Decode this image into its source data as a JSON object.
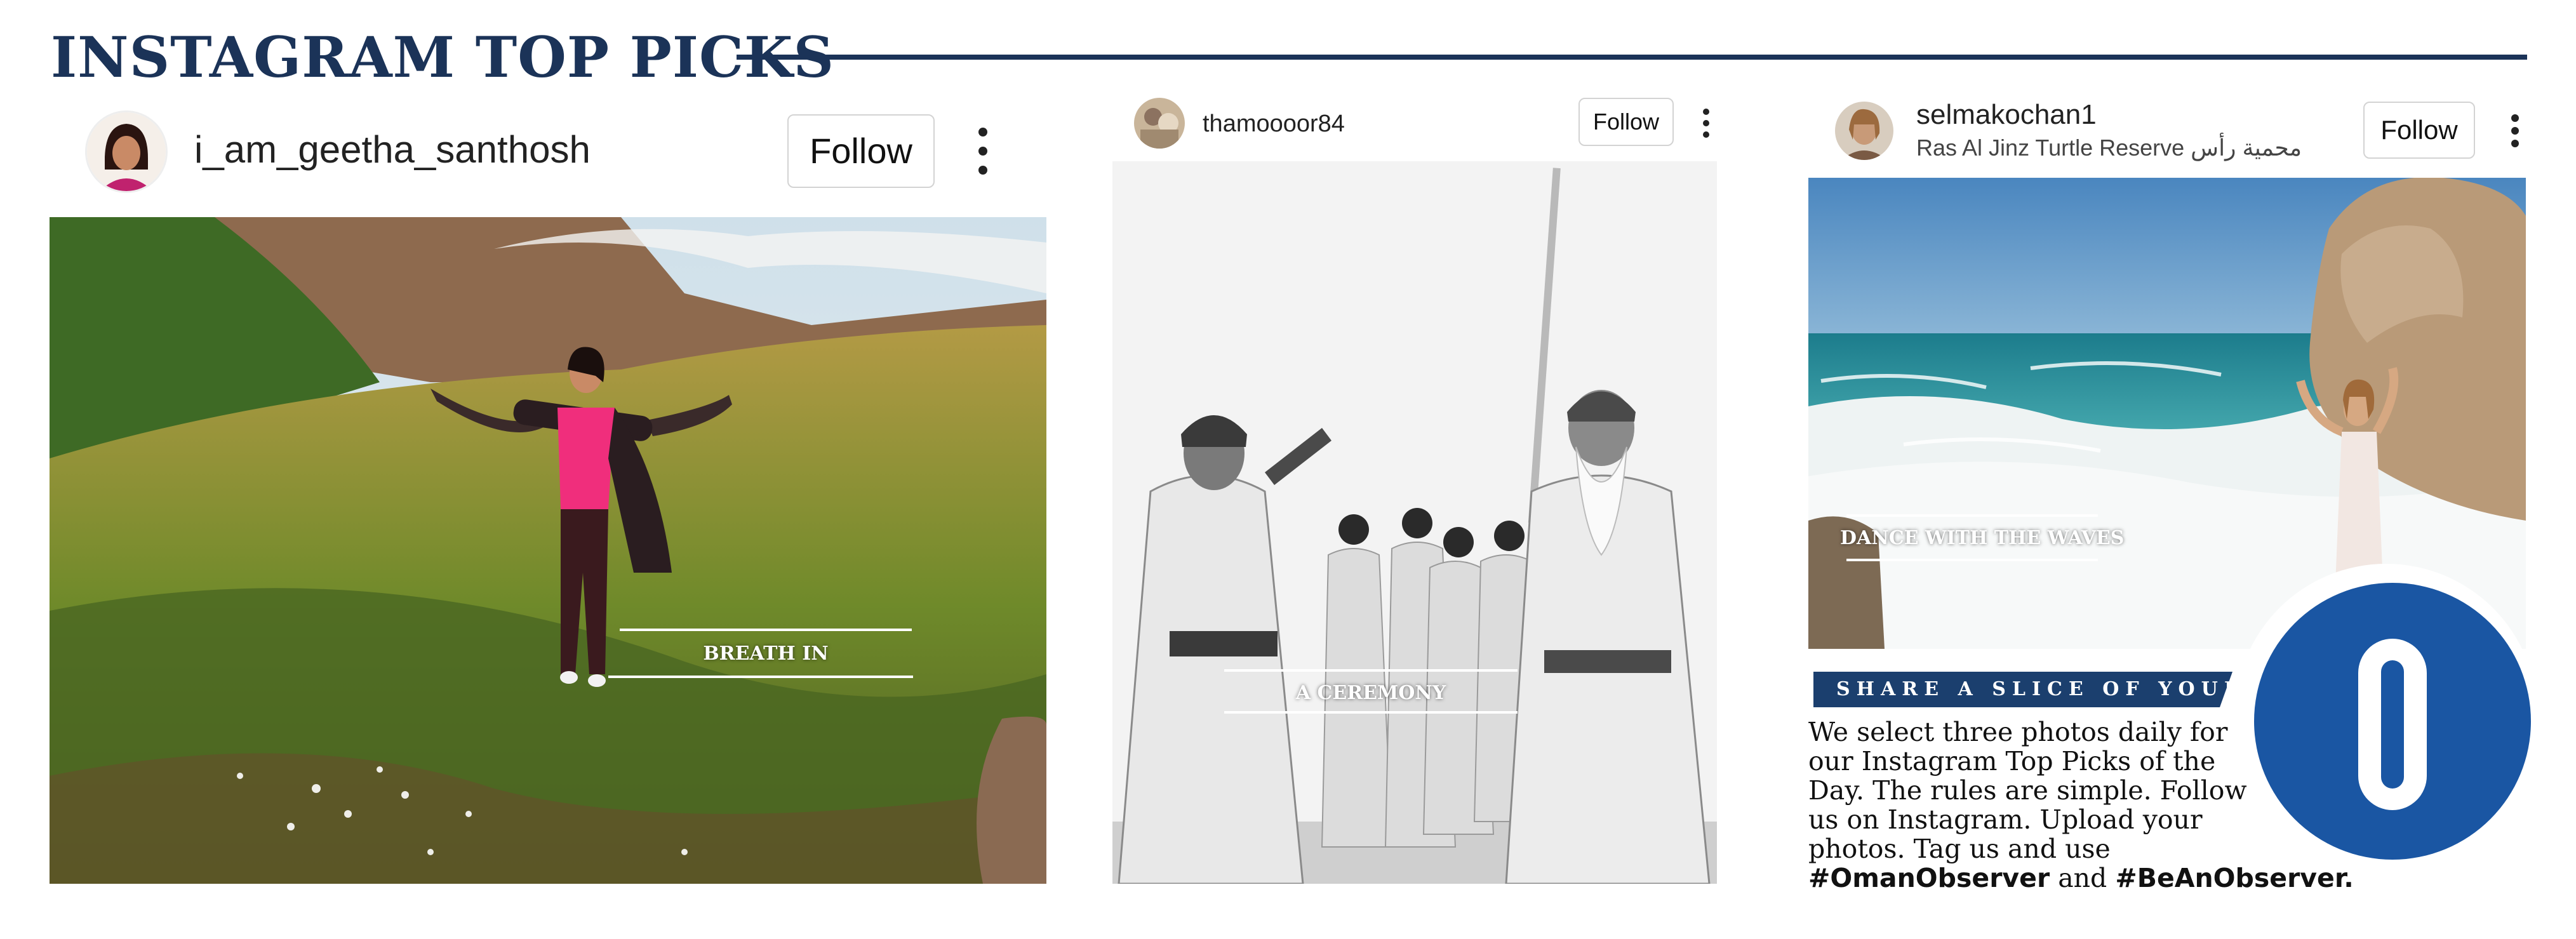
{
  "header": {
    "title": "INSTAGRAM TOP PICKS"
  },
  "posts": [
    {
      "username": "i_am_geetha_santhosh",
      "follow_label": "Follow",
      "menu_icon": "more-vertical-icon",
      "caption": "BREATH IN"
    },
    {
      "username": "thamoooor84",
      "follow_label": "Follow",
      "menu_icon": "more-vertical-icon",
      "caption": "A CEREMONY"
    },
    {
      "username": "selmakochan1",
      "location": "Ras Al Jinz Turtle Reserve محمية رأس",
      "follow_label": "Follow",
      "menu_icon": "more-vertical-icon",
      "caption": "DANCE WITH THE WAVES"
    }
  ],
  "promo": {
    "banner": "SHARE A SLICE OF YOUR LIFE",
    "body_lines": [
      "We select three photos daily for",
      "our Instagram Top Picks of the",
      "Day. The rules are simple. Follow",
      "us on Instagram. Upload your",
      "photos. Tag us and use"
    ],
    "hashtag_1": "#OmanObserver",
    "and_text": " and ",
    "hashtag_2": "#BeAnObserver.",
    "logo_letter": "O",
    "colors": {
      "navy": "#1b3358",
      "logo_blue": "#1a56a3",
      "banner_blue": "#1b3f6e"
    }
  }
}
